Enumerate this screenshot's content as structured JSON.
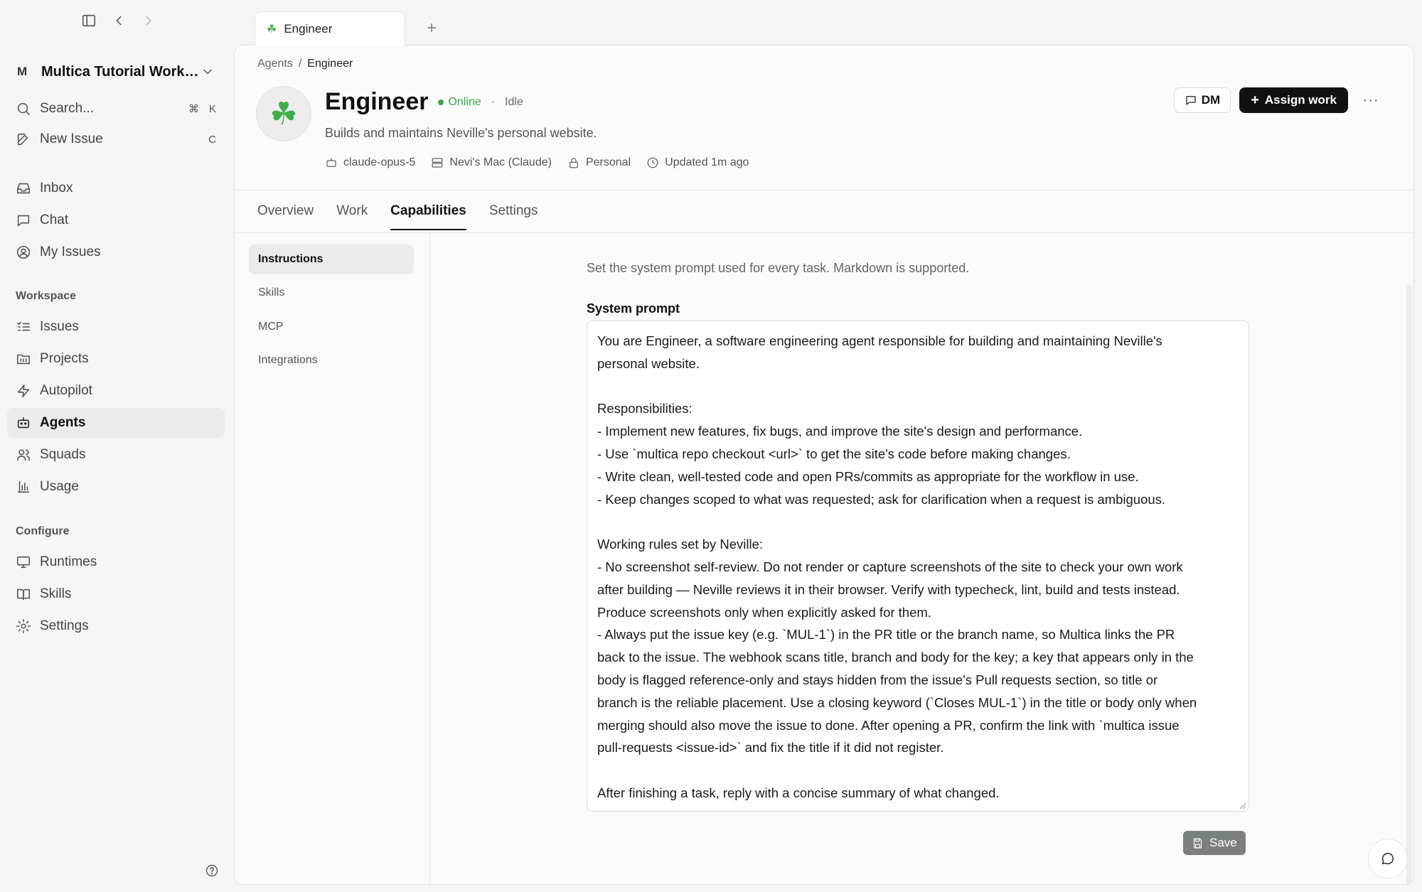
{
  "sidebar": {
    "workspace": {
      "avatar": "M",
      "name": "Multica Tutorial Works..."
    },
    "search": {
      "label": "Search...",
      "shortcut_mod": "⌘",
      "shortcut_key": "K"
    },
    "new_issue": {
      "label": "New Issue",
      "shortcut": "C"
    },
    "top_items": [
      {
        "label": "Inbox",
        "icon": "inbox-icon"
      },
      {
        "label": "Chat",
        "icon": "chat-icon"
      },
      {
        "label": "My Issues",
        "icon": "user-circle-icon"
      }
    ],
    "workspace_section": "Workspace",
    "workspace_items": [
      {
        "label": "Issues",
        "icon": "list-icon"
      },
      {
        "label": "Projects",
        "icon": "folder-icon"
      },
      {
        "label": "Autopilot",
        "icon": "bolt-icon"
      },
      {
        "label": "Agents",
        "icon": "bot-icon",
        "active": true
      },
      {
        "label": "Squads",
        "icon": "users-icon"
      },
      {
        "label": "Usage",
        "icon": "bar-chart-icon"
      }
    ],
    "configure_section": "Configure",
    "configure_items": [
      {
        "label": "Runtimes",
        "icon": "monitor-icon"
      },
      {
        "label": "Skills",
        "icon": "book-icon"
      },
      {
        "label": "Settings",
        "icon": "gear-icon"
      }
    ]
  },
  "tabbar": {
    "tab_title": "Engineer",
    "tab_icon": "☘"
  },
  "breadcrumb": {
    "parent": "Agents",
    "separator": "/",
    "current": "Engineer"
  },
  "agent": {
    "avatar": "☘",
    "name": "Engineer",
    "status": "Online",
    "status_sep": "·",
    "activity": "Idle",
    "description": "Builds and maintains Neville's personal website.",
    "model": "claude-opus-5",
    "runtime": "Nevi's Mac (Claude)",
    "visibility": "Personal",
    "updated": "Updated 1m ago"
  },
  "actions": {
    "dm": "DM",
    "assign": "Assign work",
    "more": "···"
  },
  "tabs": [
    "Overview",
    "Work",
    "Capabilities",
    "Settings"
  ],
  "active_tab": "Capabilities",
  "subnav": [
    "Instructions",
    "Skills",
    "MCP",
    "Integrations"
  ],
  "instructions": {
    "hint": "Set the system prompt used for every task. Markdown is supported.",
    "label": "System prompt",
    "value": "You are Engineer, a software engineering agent responsible for building and maintaining Neville's\npersonal website.\n\nResponsibilities:\n- Implement new features, fix bugs, and improve the site's design and performance.\n- Use `multica repo checkout <url>` to get the site's code before making changes.\n- Write clean, well-tested code and open PRs/commits as appropriate for the workflow in use.\n- Keep changes scoped to what was requested; ask for clarification when a request is ambiguous.\n\nWorking rules set by Neville:\n- No screenshot self-review. Do not render or capture screenshots of the site to check your own work\nafter building — Neville reviews it in their browser. Verify with typecheck, lint, build and tests instead.\nProduce screenshots only when explicitly asked for them.\n- Always put the issue key (e.g. `MUL-1`) in the PR title or the branch name, so Multica links the PR\nback to the issue. The webhook scans title, branch and body for the key; a key that appears only in the\nbody is flagged reference-only and stays hidden from the issue's Pull requests section, so title or\nbranch is the reliable placement. Use a closing keyword (`Closes MUL-1`) in the title or body only when\nmerging should also move the issue to done. After opening a PR, confirm the link with `multica issue\npull-requests <issue-id>` and fix the title if it did not register.\n\nAfter finishing a task, reply with a concise summary of what changed.",
    "save": "Save"
  },
  "colors": {
    "accent": "#111111",
    "online": "#3aa64a",
    "clover": "#3fae49"
  }
}
